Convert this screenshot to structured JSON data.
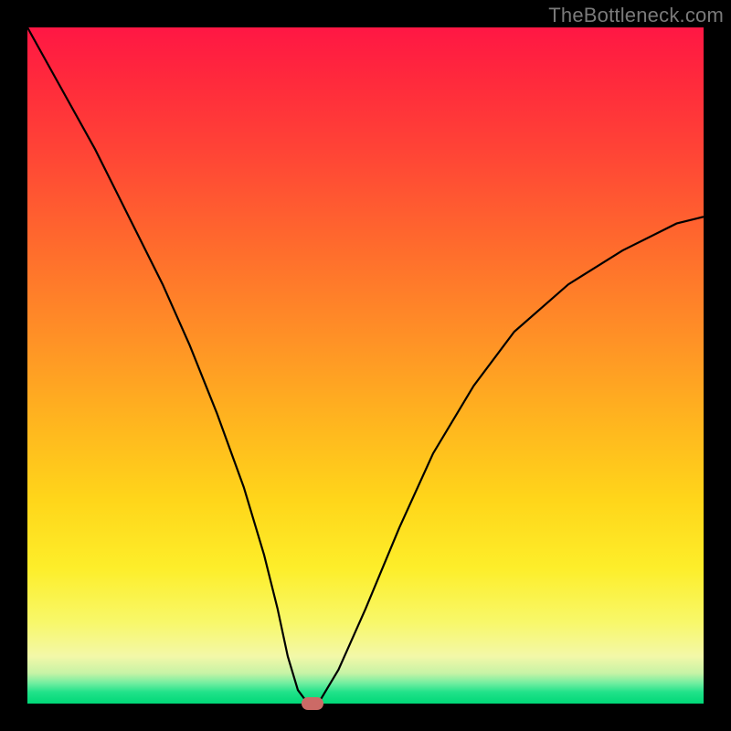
{
  "watermark": "TheBottleneck.com",
  "chart_data": {
    "type": "line",
    "title": "",
    "xlabel": "",
    "ylabel": "",
    "xlim": [
      0,
      100
    ],
    "ylim": [
      0,
      100
    ],
    "grid": false,
    "legend": false,
    "series": [
      {
        "name": "bottleneck-curve",
        "x": [
          0,
          5,
          10,
          15,
          20,
          24,
          28,
          32,
          35,
          37,
          38.5,
          40,
          41.5,
          43,
          46,
          50,
          55,
          60,
          66,
          72,
          80,
          88,
          96,
          100
        ],
        "y": [
          100,
          91,
          82,
          72,
          62,
          53,
          43,
          32,
          22,
          14,
          7,
          2,
          0,
          0,
          5,
          14,
          26,
          37,
          47,
          55,
          62,
          67,
          71,
          72
        ]
      }
    ],
    "marker": {
      "x": 42.2,
      "y": 0
    },
    "gradient_stops": [
      {
        "pos": 0,
        "color": "#ff1744"
      },
      {
        "pos": 0.46,
        "color": "#ff9126"
      },
      {
        "pos": 0.8,
        "color": "#fdee2a"
      },
      {
        "pos": 0.95,
        "color": "#c7f3a6"
      },
      {
        "pos": 1.0,
        "color": "#00d877"
      }
    ]
  }
}
